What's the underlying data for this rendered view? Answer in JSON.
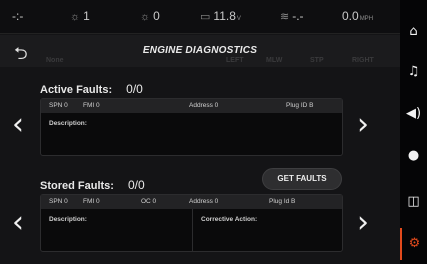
{
  "status": {
    "a": "-:-",
    "b_value": "1",
    "c_value": "0",
    "battery_value": "11.8",
    "battery_unit": "V",
    "signal_value": "-.-",
    "speed_value": "0.0",
    "speed_unit": "MPH"
  },
  "title": "ENGINE DIAGNOSTICS",
  "ghost_labels": {
    "a": "LEFT",
    "b": "MLW",
    "c": "STP",
    "d": "RIGHT",
    "e": "None"
  },
  "active": {
    "label": "Active Faults:",
    "count": "0/0",
    "spn": "SPN 0",
    "fmi": "FMI 0",
    "address": "Address 0",
    "plug": "Plug ID B",
    "description_label": "Description:"
  },
  "stored": {
    "label": "Stored Faults:",
    "count": "0/0",
    "spn": "SPN 0",
    "fmi": "FMI 0",
    "oc": "OC 0",
    "address": "Address 0",
    "plug": "Plug Id B",
    "description_label": "Description:",
    "corrective_label": "Corrective Action:"
  },
  "get_faults_label": "GET FAULTS",
  "icons": {
    "back": "back-icon",
    "left": "chevron-left-icon",
    "right": "chevron-right-icon",
    "home": "home-icon",
    "music": "music-icon",
    "volume": "volume-icon",
    "light": "light-icon",
    "toggle": "toggle-icon",
    "settings": "gear-icon"
  },
  "accent": "#e24a1c"
}
